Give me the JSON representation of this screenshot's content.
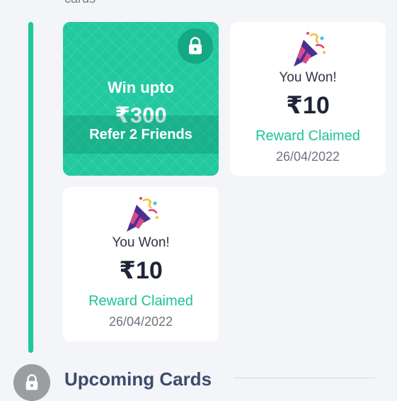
{
  "section_header_cut": "cards",
  "locked_card": {
    "title": "Win upto",
    "amount": "₹300",
    "condition": "Refer 2 Friends",
    "icon": "lock-icon"
  },
  "won_cards": [
    {
      "icon": "party-popper-icon",
      "heading": "You Won!",
      "amount": "₹10",
      "status": "Reward Claimed",
      "date": "26/04/2022"
    },
    {
      "icon": "party-popper-icon",
      "heading": "You Won!",
      "amount": "₹10",
      "status": "Reward Claimed",
      "date": "26/04/2022"
    }
  ],
  "upcoming": {
    "title": "Upcoming Cards",
    "icon": "lock-icon"
  },
  "colors": {
    "accent": "#1fc79a",
    "locked_card_bg": "#22c9a0",
    "claimed_text": "#1cc497",
    "heading_text": "#3f4a6a",
    "background": "#f3f5f8"
  }
}
